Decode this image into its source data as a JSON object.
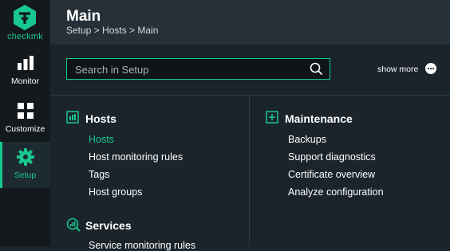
{
  "brand": {
    "logo_text": "checkmk",
    "accent": "#17c88f"
  },
  "nav": [
    {
      "label": "Monitor",
      "icon": "monitor-icon"
    },
    {
      "label": "Customize",
      "icon": "customize-icon"
    },
    {
      "label": "Setup",
      "icon": "setup-gear-icon",
      "active": true
    }
  ],
  "header": {
    "title": "Main",
    "breadcrumb": "Setup > Hosts > Main"
  },
  "search": {
    "placeholder": "Search in Setup",
    "value": ""
  },
  "show_more": {
    "label": "show more",
    "icon": "more-dots-icon"
  },
  "sections": {
    "hosts": {
      "title": "Hosts",
      "icon": "hosts-icon",
      "items": [
        "Hosts",
        "Host monitoring rules",
        "Tags",
        "Host groups"
      ],
      "active_item": "Hosts"
    },
    "maintenance": {
      "title": "Maintenance",
      "icon": "maintenance-plus-icon",
      "items": [
        "Backups",
        "Support diagnostics",
        "Certificate overview",
        "Analyze configuration"
      ]
    },
    "services": {
      "title": "Services",
      "icon": "services-icon",
      "items": [
        "Service monitoring rules"
      ]
    }
  }
}
